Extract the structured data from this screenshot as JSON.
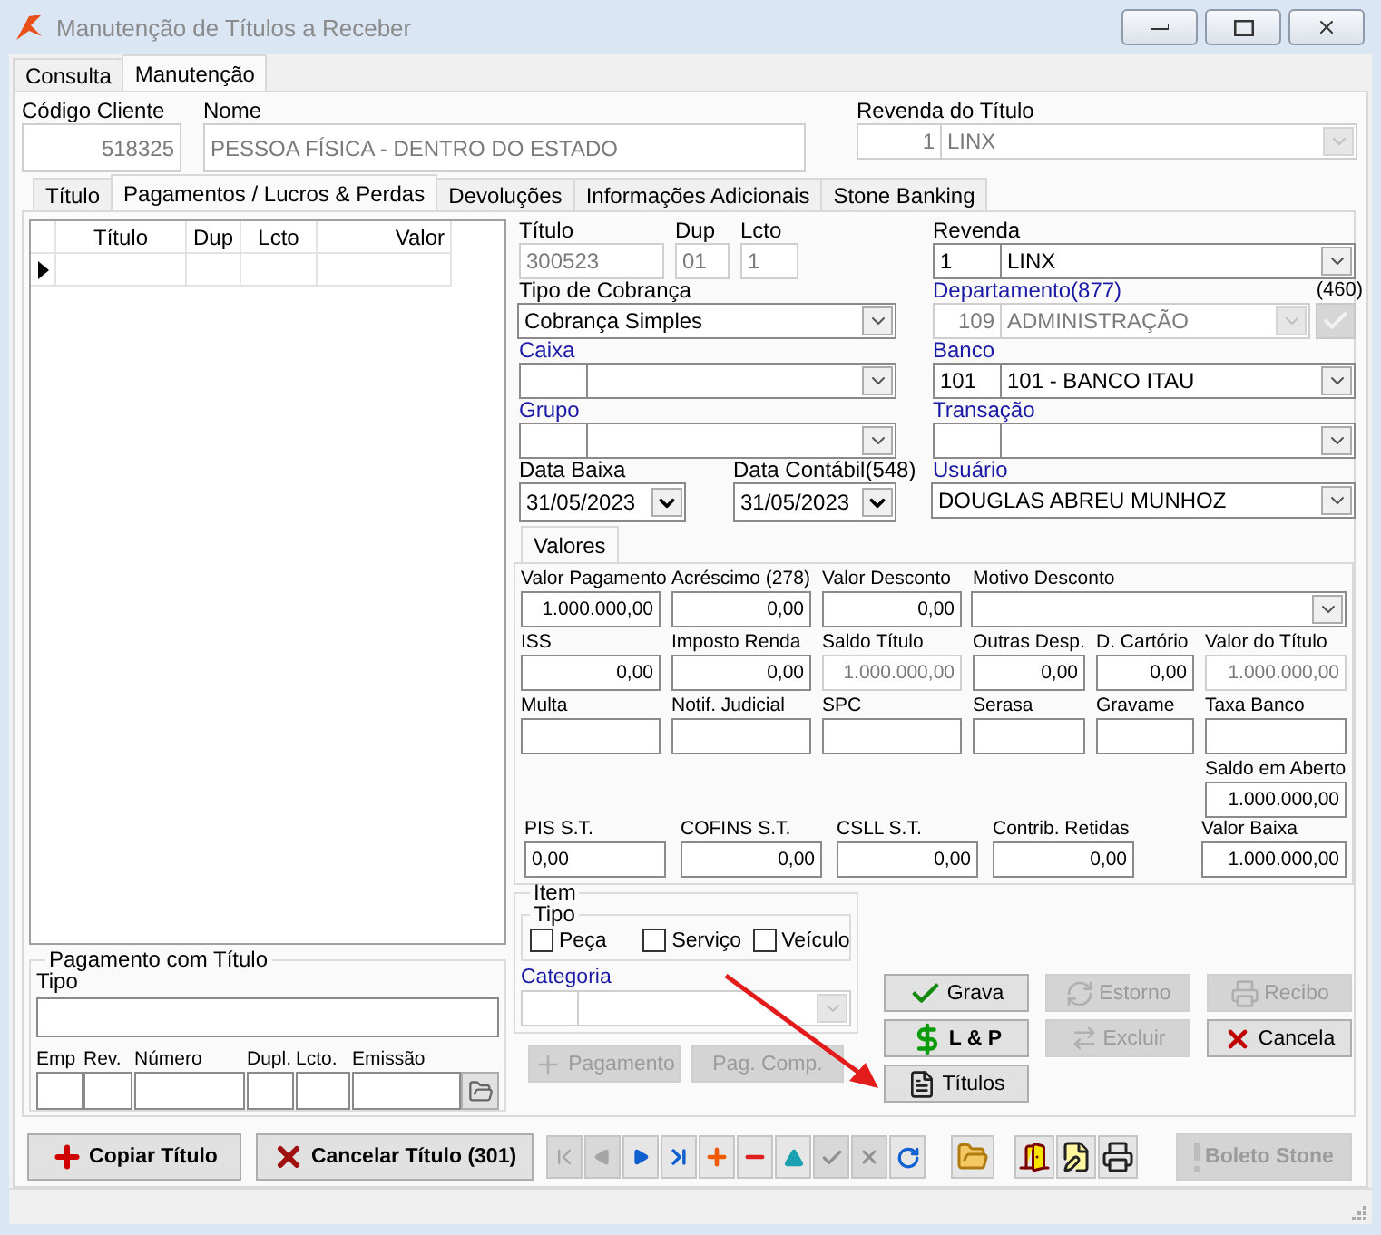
{
  "window": {
    "title": "Manutenção de Títulos a Receber"
  },
  "main_tabs": [
    {
      "label": "Consulta",
      "selected": false
    },
    {
      "label": "Manutenção",
      "selected": true
    }
  ],
  "header": {
    "code": {
      "label": "Código Cliente",
      "value": "518325",
      "disabled": true
    },
    "name": {
      "label": "Nome",
      "value": "PESSOA FÍSICA - DENTRO DO ESTADO",
      "disabled": true
    },
    "revenda": {
      "label": "Revenda do Título",
      "code": "1",
      "value": "LINX",
      "disabled": true
    }
  },
  "sub_tabs": [
    {
      "label": "Título",
      "selected": false
    },
    {
      "label": "Pagamentos / Lucros & Perdas",
      "selected": true
    },
    {
      "label": "Devoluções",
      "selected": false
    },
    {
      "label": "Informações Adicionais",
      "selected": false
    },
    {
      "label": "Stone Banking",
      "selected": false
    }
  ],
  "payments_table": {
    "columns": [
      "Título",
      "Dup",
      "Lcto",
      "Valor"
    ],
    "rows": [
      {
        "current": true
      }
    ]
  },
  "pagamento_com_titulo": {
    "title": "Pagamento com Título",
    "tipo_label": "Tipo",
    "columns": [
      "Emp",
      "Rev.",
      "Número",
      "Dupl.",
      "Lcto.",
      "Emissão"
    ]
  },
  "titulo": {
    "numero": {
      "label": "Título",
      "value": "300523",
      "disabled": true
    },
    "dup": {
      "label": "Dup",
      "value": "01",
      "disabled": true
    },
    "lcto": {
      "label": "Lcto",
      "value": "1",
      "disabled": true
    }
  },
  "tipo_cobranca": {
    "label": "Tipo de Cobrança",
    "value": "Cobrança Simples"
  },
  "caixa": {
    "label": "Caixa",
    "link": true
  },
  "grupo": {
    "label": "Grupo",
    "link": true
  },
  "data_baixa": {
    "label": "Data Baixa",
    "value": "31/05/2023"
  },
  "data_contabil": {
    "label": "Data Contábil(548)",
    "value": "31/05/2023"
  },
  "revenda": {
    "label": "Revenda",
    "code": "1",
    "value": "LINX"
  },
  "departamento": {
    "label": "Departamento(877)",
    "link": true,
    "code": "109",
    "value": "ADMINISTRAÇÃO",
    "disabled": true,
    "count": "(460)",
    "check_disabled": true
  },
  "banco": {
    "label": "Banco",
    "link": true,
    "code": "101",
    "value": "101 - BANCO ITAU"
  },
  "transacao": {
    "label": "Transação",
    "link": true
  },
  "usuario": {
    "label": "Usuário",
    "link": true,
    "value": "DOUGLAS ABREU MUNHOZ"
  },
  "values_tabs": [
    {
      "label": "Valores",
      "selected": true
    }
  ],
  "values_grid": [
    [
      {
        "label": "Valor Pagamento",
        "value": "1.000.000,00",
        "kind": "number",
        "disabled": false
      },
      {
        "label": "Acréscimo (278)",
        "value": "0,00",
        "kind": "number",
        "disabled": false
      },
      {
        "label": "Valor Desconto",
        "value": "0,00",
        "kind": "number",
        "disabled": false
      },
      {
        "label": "Motivo Desconto",
        "kind": "combo",
        "disabled": false
      }
    ],
    [
      {
        "label": "ISS",
        "value": "0,00",
        "kind": "number",
        "disabled": false
      },
      {
        "label": "Imposto Renda",
        "value": "0,00",
        "kind": "number",
        "disabled": false
      },
      {
        "label": "Saldo Título",
        "value": "1.000.000,00",
        "kind": "number",
        "disabled": true
      },
      {
        "label": "Outras Desp.",
        "value": "0,00",
        "kind": "number",
        "disabled": false
      },
      {
        "label": "D. Cartório",
        "value": "0,00",
        "kind": "number",
        "disabled": false
      },
      {
        "label": "Valor do Título",
        "value": "1.000.000,00",
        "kind": "number",
        "disabled": true
      }
    ],
    [
      {
        "label": "Multa",
        "kind": "number",
        "disabled": false
      },
      {
        "label": "Notif. Judicial",
        "kind": "number",
        "disabled": false
      },
      {
        "label": "SPC",
        "kind": "number",
        "disabled": false
      },
      {
        "label": "Serasa",
        "kind": "number",
        "disabled": false
      },
      {
        "label": "Gravame",
        "kind": "number",
        "disabled": false
      },
      {
        "label": "Taxa Banco",
        "kind": "number",
        "disabled": false
      }
    ]
  ],
  "saldo_aberto": {
    "label": "Saldo em Aberto",
    "value": "1.000.000,00"
  },
  "st_row": [
    {
      "label": "PIS S.T.",
      "value": "0,00",
      "kind": "text"
    },
    {
      "label": "COFINS S.T.",
      "value": "0,00",
      "kind": "number"
    },
    {
      "label": "CSLL S.T.",
      "value": "0,00",
      "kind": "number"
    },
    {
      "label": "Contrib. Retidas",
      "value": "0,00",
      "kind": "number"
    },
    {
      "label": "Valor Baixa",
      "value": "1.000.000,00",
      "kind": "number"
    }
  ],
  "item": {
    "title": "Item",
    "tipo_title": "Tipo",
    "tipos": [
      {
        "label": "Peça",
        "checked": false
      },
      {
        "label": "Serviço",
        "checked": false
      },
      {
        "label": "Veículo",
        "checked": false
      }
    ],
    "categoria": {
      "label": "Categoria",
      "link": true,
      "disabled": true
    }
  },
  "payment_buttons": [
    {
      "label": "Pagamento",
      "kind": "plus",
      "disabled": true
    },
    {
      "label": "Pag. Comp.",
      "kind": "plain",
      "disabled": true
    }
  ],
  "actions": [
    {
      "label": "Grava",
      "kind": "check",
      "disabled": false,
      "bold": false
    },
    {
      "label": "Estorno",
      "kind": "refresh",
      "disabled": true,
      "bold": false
    },
    {
      "label": "Recibo",
      "kind": "printer",
      "disabled": true,
      "bold": false
    },
    {
      "label": "L & P",
      "kind": "dollar",
      "disabled": false,
      "bold": true
    },
    {
      "label": "Excluir",
      "kind": "swap",
      "disabled": true,
      "bold": false
    },
    {
      "label": "Cancela",
      "kind": "x",
      "disabled": false,
      "bold": false
    },
    {
      "label": "Títulos",
      "kind": "document",
      "disabled": false,
      "bold": false
    }
  ],
  "toolbar": {
    "copy": {
      "label": "Copiar Título"
    },
    "cancel": {
      "label": "Cancelar Título (301)"
    },
    "navigator": [
      {
        "kind": "first",
        "disabled": true
      },
      {
        "kind": "prior",
        "disabled": true
      },
      {
        "kind": "next",
        "disabled": false
      },
      {
        "kind": "last",
        "disabled": false
      },
      {
        "kind": "insert",
        "disabled": false
      },
      {
        "kind": "delete",
        "disabled": false
      },
      {
        "kind": "edit",
        "disabled": false
      },
      {
        "kind": "post",
        "disabled": true
      },
      {
        "kind": "cancel",
        "disabled": true
      },
      {
        "kind": "refresh",
        "disabled": false
      }
    ],
    "tools": [
      {
        "kind": "folder"
      },
      {
        "kind": "door"
      },
      {
        "kind": "edit_doc"
      },
      {
        "kind": "printer"
      }
    ],
    "boleto": {
      "label": "Boleto Stone",
      "disabled": true
    }
  }
}
